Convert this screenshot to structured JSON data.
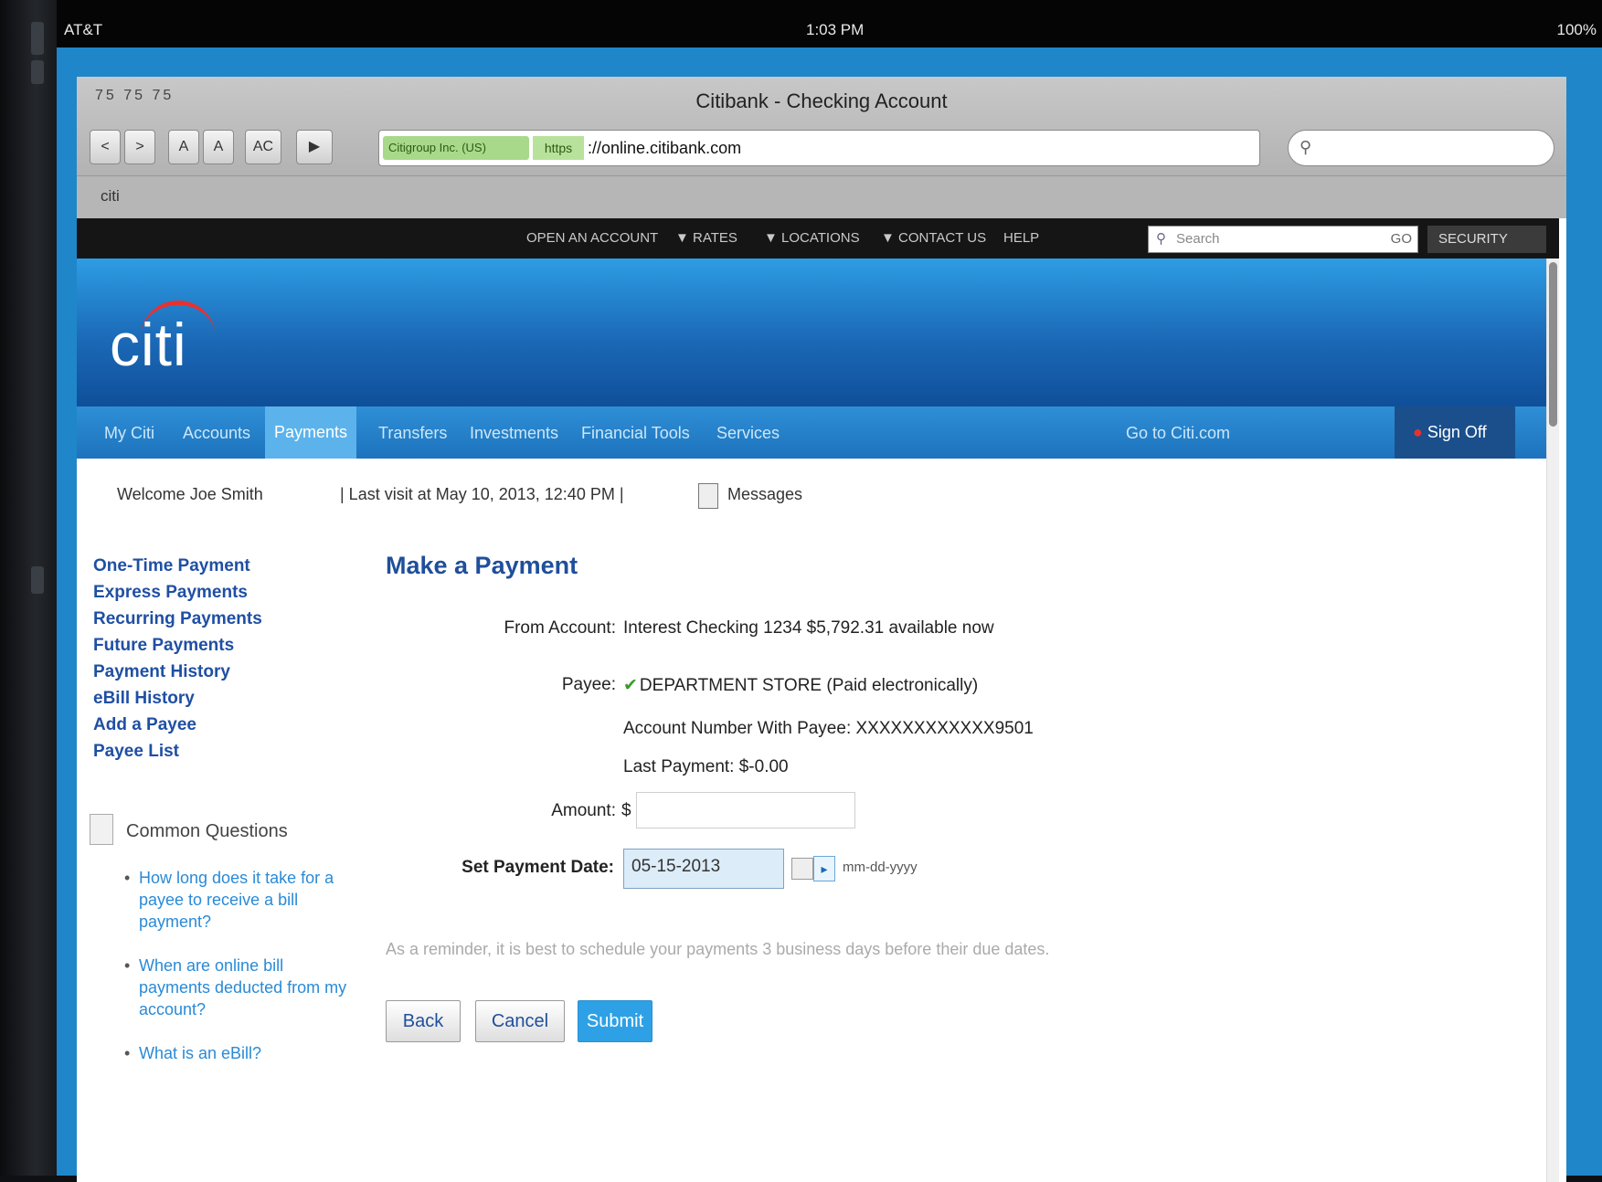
{
  "statusbar": {
    "carrier": "AT&T",
    "time": "1:03 PM",
    "battery": "100%"
  },
  "browser": {
    "window_controls": "75 75 75",
    "title": "Citibank - Checking Account",
    "secure_badge": "Citigroup Inc. (US)",
    "https": "https",
    "url": "://online.citibank.com",
    "search_icon": "magnifier-icon",
    "tab_label": "citi",
    "nav_buttons": [
      "<",
      ">",
      "A",
      "A",
      "AC",
      "▶"
    ]
  },
  "topbar": {
    "links": [
      "OPEN AN ACCOUNT",
      "▼ RATES",
      "▼ LOCATIONS",
      "▼ CONTACT US",
      "HELP"
    ],
    "search_placeholder": "Search",
    "search_go": "GO",
    "security": "SECURITY"
  },
  "logo": "citi",
  "mainnav": {
    "items": [
      "My Citi",
      "Accounts",
      "Payments",
      "Transfers",
      "Investments",
      "Financial Tools",
      "Services"
    ],
    "go_to": "Go to Citi.com",
    "signoff": "Sign Off"
  },
  "welcome": {
    "greeting": "Welcome Joe Smith",
    "last_visit": "| Last visit at May 10, 2013, 12:40 PM |",
    "messages": "Messages"
  },
  "sidenav": [
    "One-Time Payment",
    "Express Payments",
    "Recurring Payments",
    "Future Payments",
    "Payment History",
    "eBill History",
    "Add a Payee",
    "Payee List"
  ],
  "common_questions": {
    "title": "Common Questions",
    "items": [
      "How long does it take for a payee to receive a bill payment?",
      "When are online bill payments deducted from my account?",
      "What is an eBill?"
    ]
  },
  "form": {
    "heading": "Make a Payment",
    "from_label": "From Account:",
    "from_value": "Interest Checking 1234 $5,792.31 available now",
    "payee_label": "Payee:",
    "payee_value": "DEPARTMENT STORE (Paid electronically)",
    "account_number": "Account Number With Payee: XXXXXXXXXXXX9501",
    "last_payment": "Last Payment: $-0.00",
    "amount_label": "Amount:",
    "amount_symbol": "$",
    "amount_value": "",
    "date_label": "Set Payment Date:",
    "date_value": "05-15-2013",
    "date_format": "mm-dd-yyyy",
    "reminder": "As a reminder, it is best to schedule your payments 3 business days before their due dates.",
    "back": "Back",
    "cancel": "Cancel",
    "submit": "Submit"
  }
}
